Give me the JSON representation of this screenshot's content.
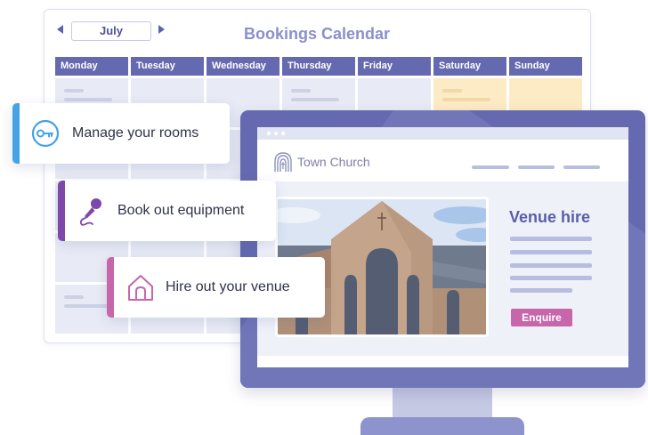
{
  "calendar": {
    "month": "July",
    "title": "Bookings Calendar",
    "days": [
      "Monday",
      "Tuesday",
      "Wednesday",
      "Thursday",
      "Friday",
      "Saturday",
      "Sunday"
    ]
  },
  "features": [
    {
      "label": "Manage your rooms",
      "icon": "key-icon",
      "color": "#45a3e5"
    },
    {
      "label": "Book out equipment",
      "icon": "microphone-icon",
      "color": "#7f48a8"
    },
    {
      "label": "Hire out your venue",
      "icon": "house-icon",
      "color": "#c766aa"
    }
  ],
  "website": {
    "logo_text": "Town Church",
    "heading": "Venue hire",
    "button": "Enquire"
  },
  "colors": {
    "calendar_header": "#656ab0",
    "weekend_cell": "#fdebc5",
    "monitor": "#656ab0",
    "enquire_button": "#c766aa"
  }
}
